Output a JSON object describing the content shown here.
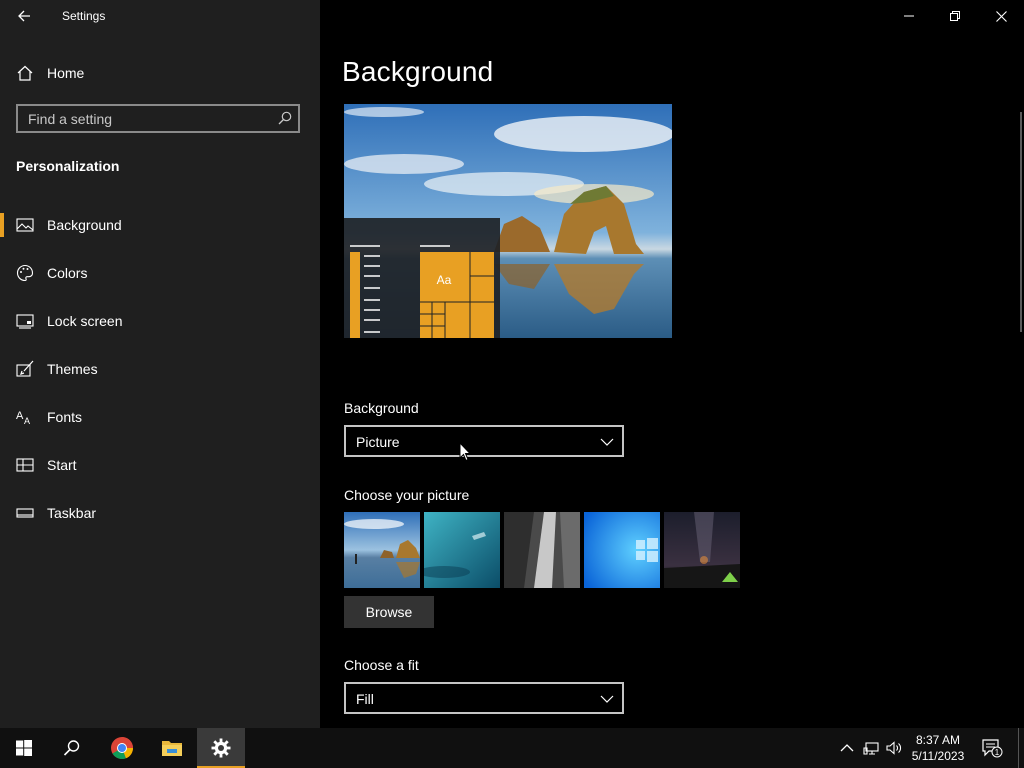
{
  "window": {
    "title": "Settings",
    "controls": [
      "minimize-icon",
      "restore-icon",
      "close-icon"
    ]
  },
  "sidebar": {
    "home_label": "Home",
    "search": {
      "placeholder": "Find a setting",
      "value": ""
    },
    "section_title": "Personalization",
    "items": [
      {
        "label": "Background",
        "icon": "picture-icon",
        "selected": true
      },
      {
        "label": "Colors",
        "icon": "palette-icon",
        "selected": false
      },
      {
        "label": "Lock screen",
        "icon": "lock-screen-icon",
        "selected": false
      },
      {
        "label": "Themes",
        "icon": "themes-brush-icon",
        "selected": false
      },
      {
        "label": "Fonts",
        "icon": "fonts-icon",
        "selected": false
      },
      {
        "label": "Start",
        "icon": "start-grid-icon",
        "selected": false
      },
      {
        "label": "Taskbar",
        "icon": "taskbar-icon",
        "selected": false
      }
    ]
  },
  "main": {
    "title": "Background",
    "preview": {
      "tile_label": "Aa"
    },
    "background_field": {
      "label": "Background",
      "value": "Picture"
    },
    "choose_picture": {
      "label": "Choose your picture",
      "thumbnails": [
        "beach-rock-arch",
        "underwater-swimmer",
        "waterfall-cliff",
        "windows-logo-blue",
        "night-sky-tent"
      ]
    },
    "browse_label": "Browse",
    "fit_field": {
      "label": "Choose a fit",
      "value": "Fill"
    }
  },
  "taskbar": {
    "apps": [
      "windows-start-icon",
      "search-icon",
      "chrome-icon",
      "file-explorer-icon",
      "settings-gear-icon"
    ],
    "active_app": "settings-gear-icon",
    "tray": [
      "chevron-up-icon",
      "network-icon",
      "volume-icon"
    ],
    "time": "8:37 AM",
    "date": "5/11/2023",
    "notification_count": "1"
  },
  "colors": {
    "accent": "#e8a023",
    "sidebar_bg": "#1f1f1f",
    "main_bg": "#000000",
    "taskbar_bg": "#101010"
  }
}
